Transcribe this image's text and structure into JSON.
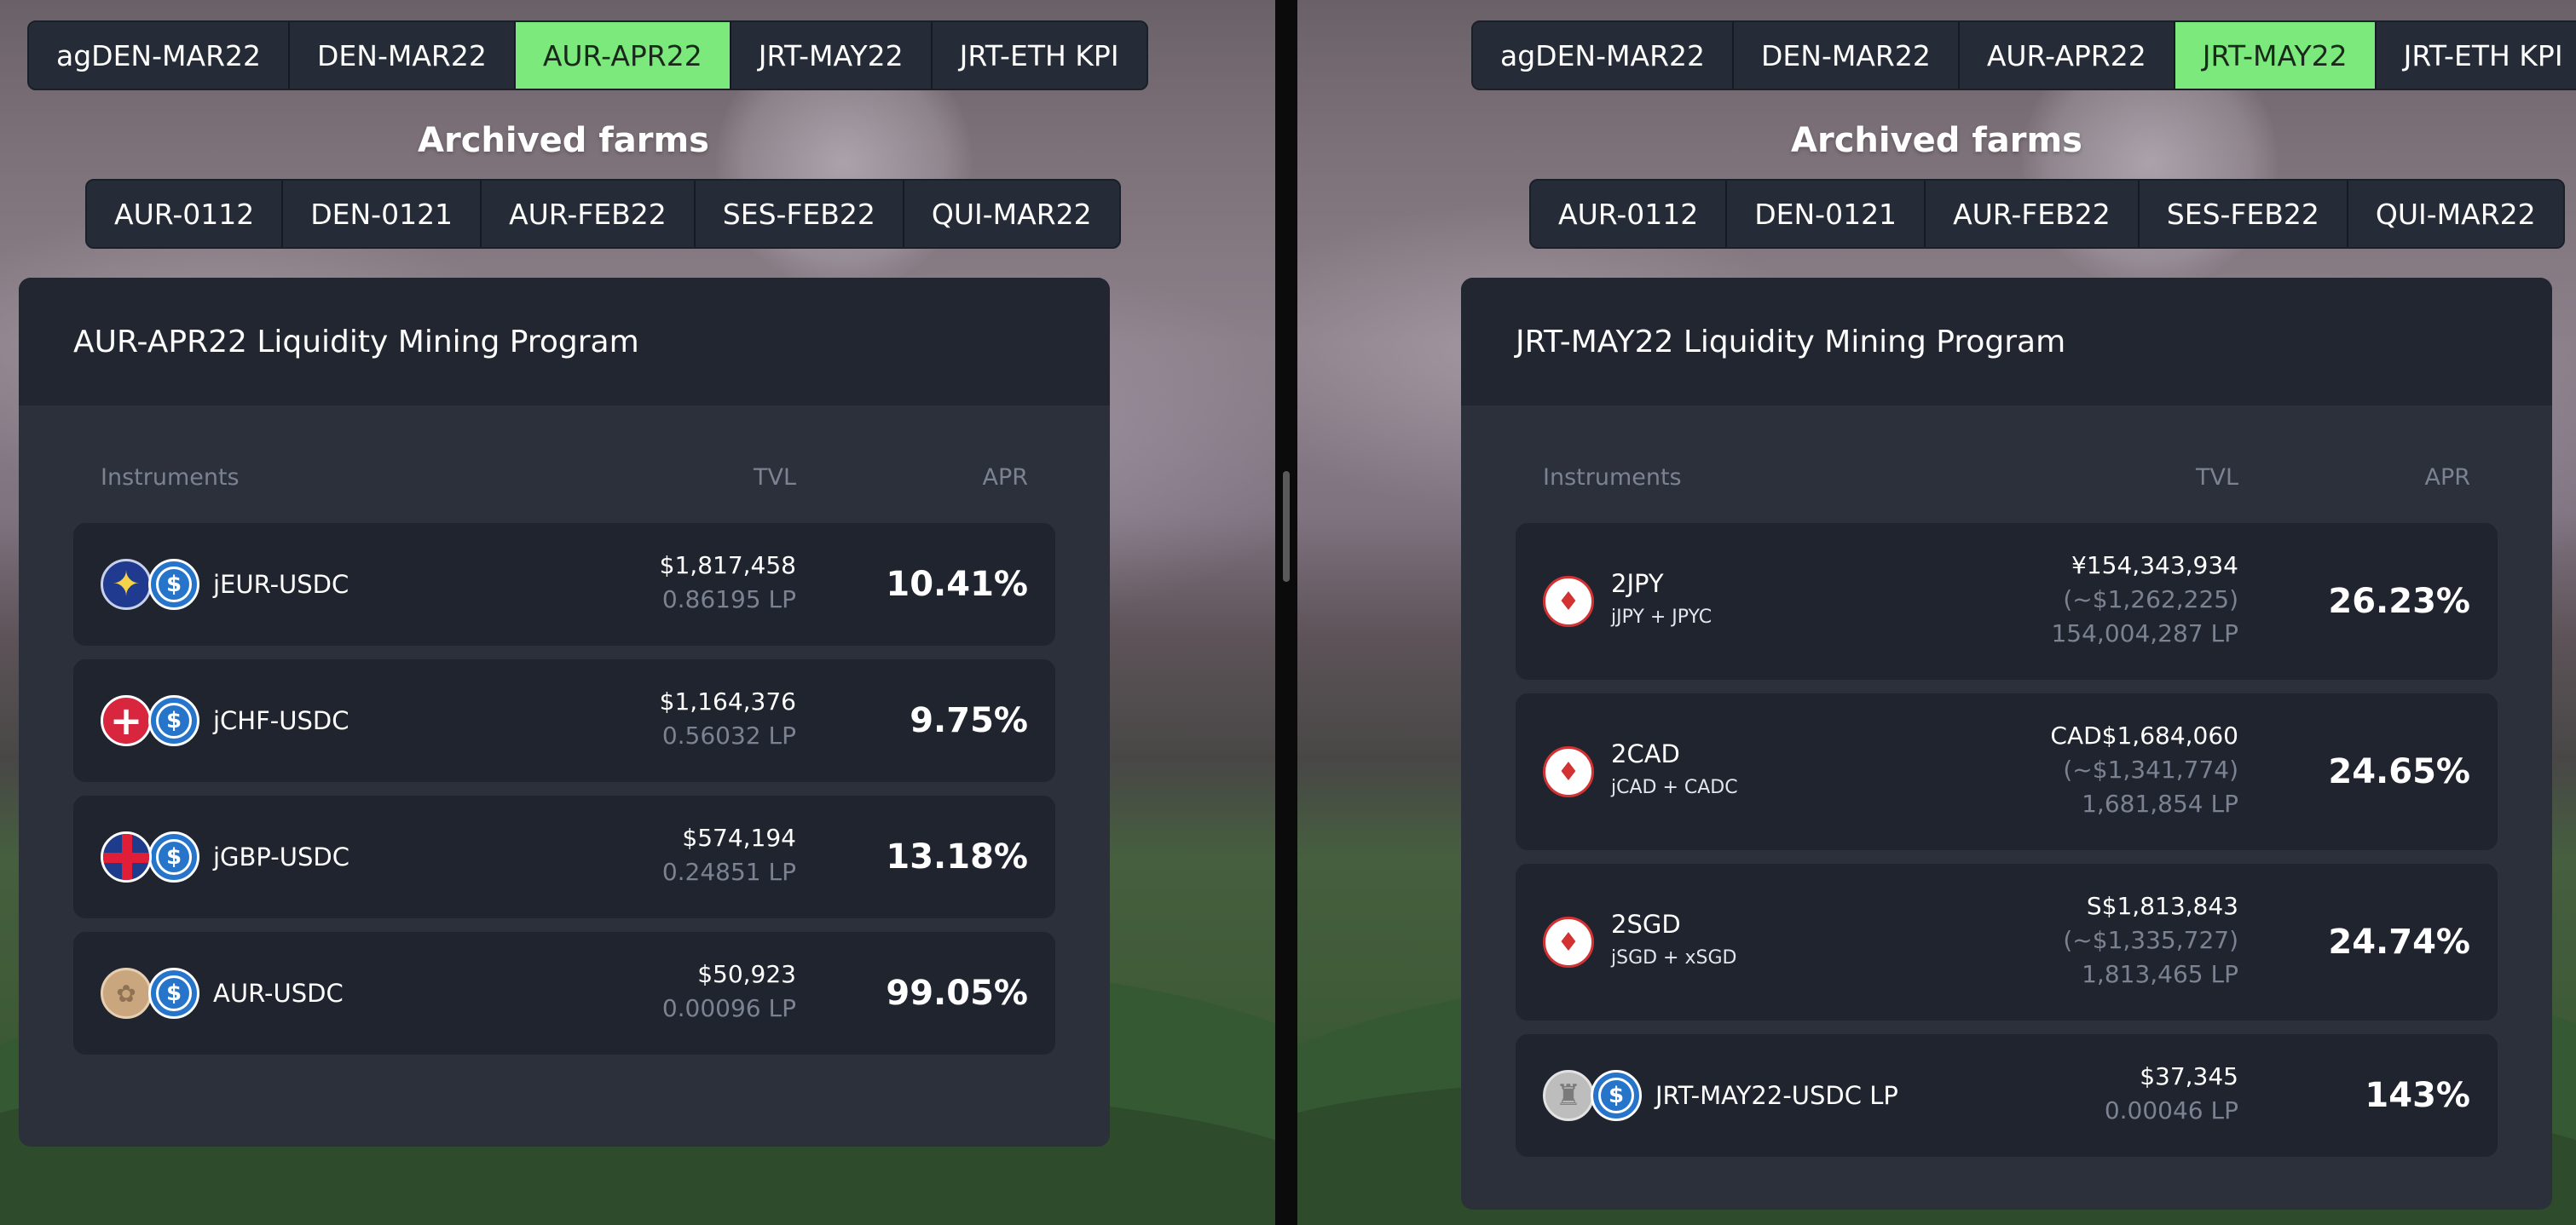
{
  "left": {
    "tabs": [
      "agDEN-MAR22",
      "DEN-MAR22",
      "AUR-APR22",
      "JRT-MAY22",
      "JRT-ETH KPI"
    ],
    "active_tab": "AUR-APR22",
    "archived_title": "Archived farms",
    "archived_tabs": [
      "AUR-0112",
      "DEN-0121",
      "AUR-FEB22",
      "SES-FEB22",
      "QUI-MAR22"
    ],
    "card_title": "AUR-APR22 Liquidity Mining Program",
    "columns": {
      "instruments": "Instruments",
      "tvl": "TVL",
      "apr": "APR"
    },
    "rows": [
      {
        "name": "jEUR-USDC",
        "tvl": "$1,817,458",
        "lp": "0.86195 LP",
        "apr": "10.41%",
        "icons": [
          "eur-icon",
          "usdc-icon"
        ]
      },
      {
        "name": "jCHF-USDC",
        "tvl": "$1,164,376",
        "lp": "0.56032 LP",
        "apr": "9.75%",
        "icons": [
          "chf-icon",
          "usdc-icon"
        ]
      },
      {
        "name": "jGBP-USDC",
        "tvl": "$574,194",
        "lp": "0.24851 LP",
        "apr": "13.18%",
        "icons": [
          "gbp-icon",
          "usdc-icon"
        ]
      },
      {
        "name": "AUR-USDC",
        "tvl": "$50,923",
        "lp": "0.00096 LP",
        "apr": "99.05%",
        "icons": [
          "aur-icon",
          "usdc-icon"
        ]
      }
    ]
  },
  "right": {
    "tabs": [
      "agDEN-MAR22",
      "DEN-MAR22",
      "AUR-APR22",
      "JRT-MAY22",
      "JRT-ETH KPI"
    ],
    "active_tab": "JRT-MAY22",
    "archived_title": "Archived farms",
    "archived_tabs": [
      "AUR-0112",
      "DEN-0121",
      "AUR-FEB22",
      "SES-FEB22",
      "QUI-MAR22"
    ],
    "card_title": "JRT-MAY22 Liquidity Mining Program",
    "columns": {
      "instruments": "Instruments",
      "tvl": "TVL",
      "apr": "APR"
    },
    "rows": [
      {
        "name": "2JPY",
        "pair": "jJPY + JPYC",
        "tvl": "¥154,343,934",
        "usd": "(~$1,262,225)",
        "lp": "154,004,287 LP",
        "apr": "26.23%",
        "icons": [
          "jpy-hero-icon"
        ]
      },
      {
        "name": "2CAD",
        "pair": "jCAD + CADC",
        "tvl": "CAD$1,684,060",
        "usd": "(~$1,341,774)",
        "lp": "1,681,854 LP",
        "apr": "24.65%",
        "icons": [
          "cad-hero-icon"
        ]
      },
      {
        "name": "2SGD",
        "pair": "jSGD + xSGD",
        "tvl": "S$1,813,843",
        "usd": "(~$1,335,727)",
        "lp": "1,813,465 LP",
        "apr": "24.74%",
        "icons": [
          "sgd-hero-icon"
        ]
      },
      {
        "name": "JRT-MAY22-USDC LP",
        "tvl": "$37,345",
        "lp": "0.00046 LP",
        "apr": "143%",
        "icons": [
          "jrt-icon",
          "usdc-icon"
        ]
      }
    ]
  },
  "colors": {
    "active_tab": "#7be97b",
    "tab_bg": "#262c37",
    "card_bg": "#2b303b",
    "card_head": "#212631",
    "row_bg": "#1f242e",
    "muted_text": "#7b8291"
  }
}
